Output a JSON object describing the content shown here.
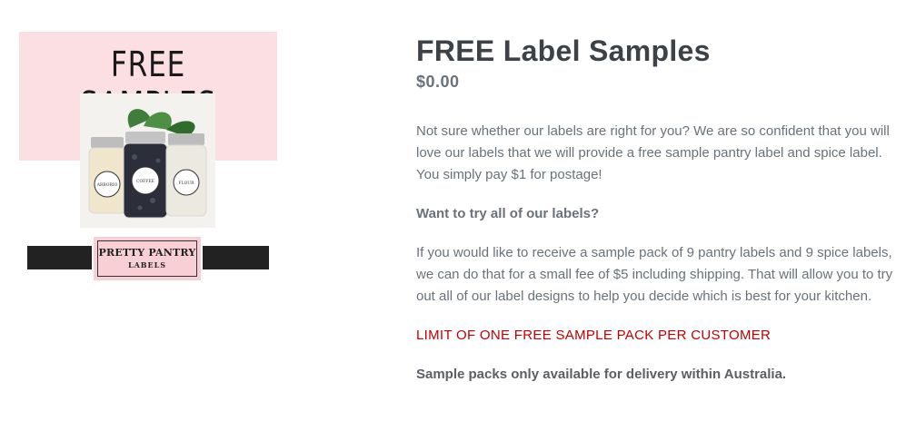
{
  "image": {
    "banner_text": "FREE SAMPLES",
    "brand_name": "PRETTY PANTRY",
    "brand_sub": "LABELS",
    "jar_labels": [
      "ARBORIO",
      "COFFEE",
      "FLOUR"
    ]
  },
  "product": {
    "title": "FREE Label Samples",
    "price": "$0.00"
  },
  "description": {
    "intro": "Not sure whether our labels are right for you? We are so confident that you will love our labels that we will provide a free sample pantry label and spice label. You simply pay $1 for postage!",
    "heading": "Want to try all of our labels?",
    "body": "If you would like to receive a sample pack of 9 pantry labels and 9 spice labels, we can do that for a small fee of $5 including shipping. That will allow you to try out all of our label designs to help you decide which is best for your kitchen.",
    "limit": "LIMIT OF ONE FREE SAMPLE PACK PER CUSTOMER",
    "delivery": "Sample packs only available for delivery within Australia."
  },
  "colors": {
    "pink": "#fcdfe3",
    "limit_red": "#c00000",
    "title": "#3d4246",
    "body_text": "#69727b"
  }
}
